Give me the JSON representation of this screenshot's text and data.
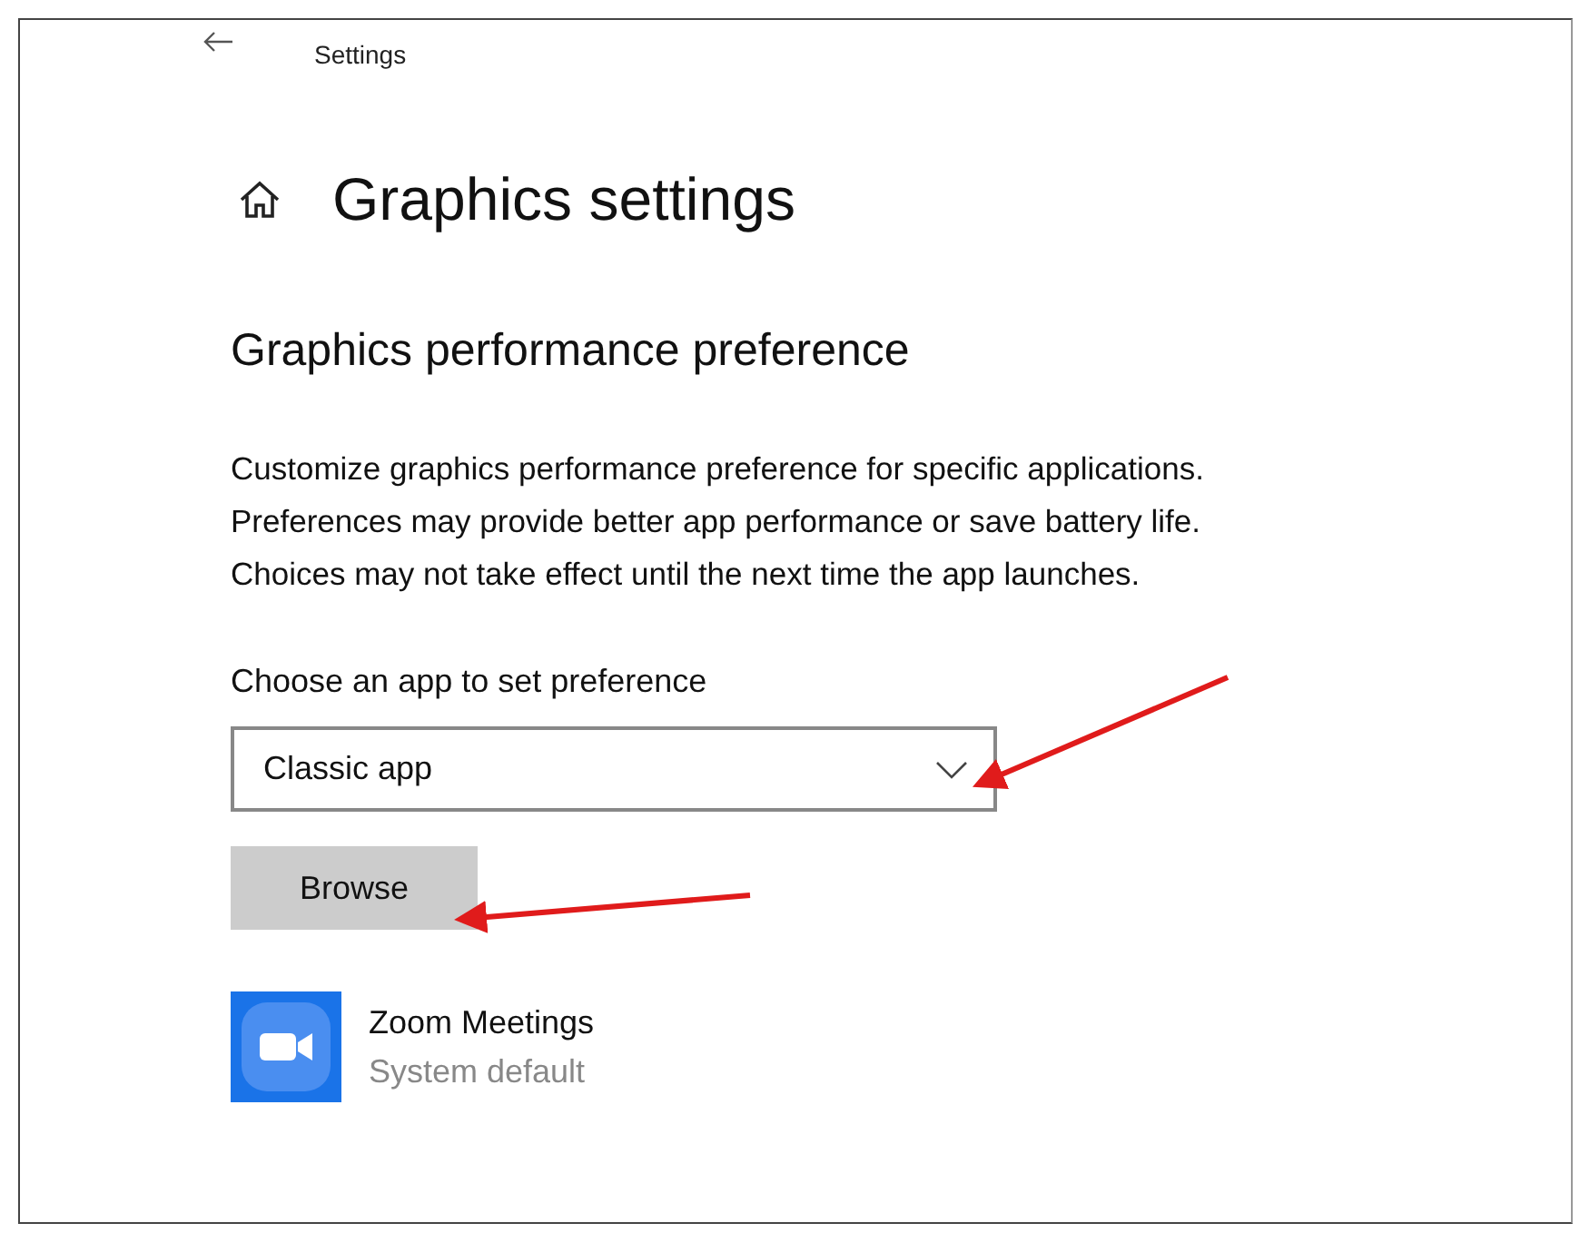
{
  "window": {
    "title": "Settings"
  },
  "page": {
    "title": "Graphics settings"
  },
  "section": {
    "heading": "Graphics performance preference",
    "description_lines": [
      "Customize graphics performance preference for specific applications.",
      "Preferences may provide better app performance or save battery life.",
      "Choices may not take effect until the next time the app launches."
    ]
  },
  "chooser": {
    "label": "Choose an app to set preference",
    "value": "Classic app"
  },
  "browse_button": "Browse",
  "apps": [
    {
      "name": "Zoom Meetings",
      "preference": "System default"
    }
  ]
}
